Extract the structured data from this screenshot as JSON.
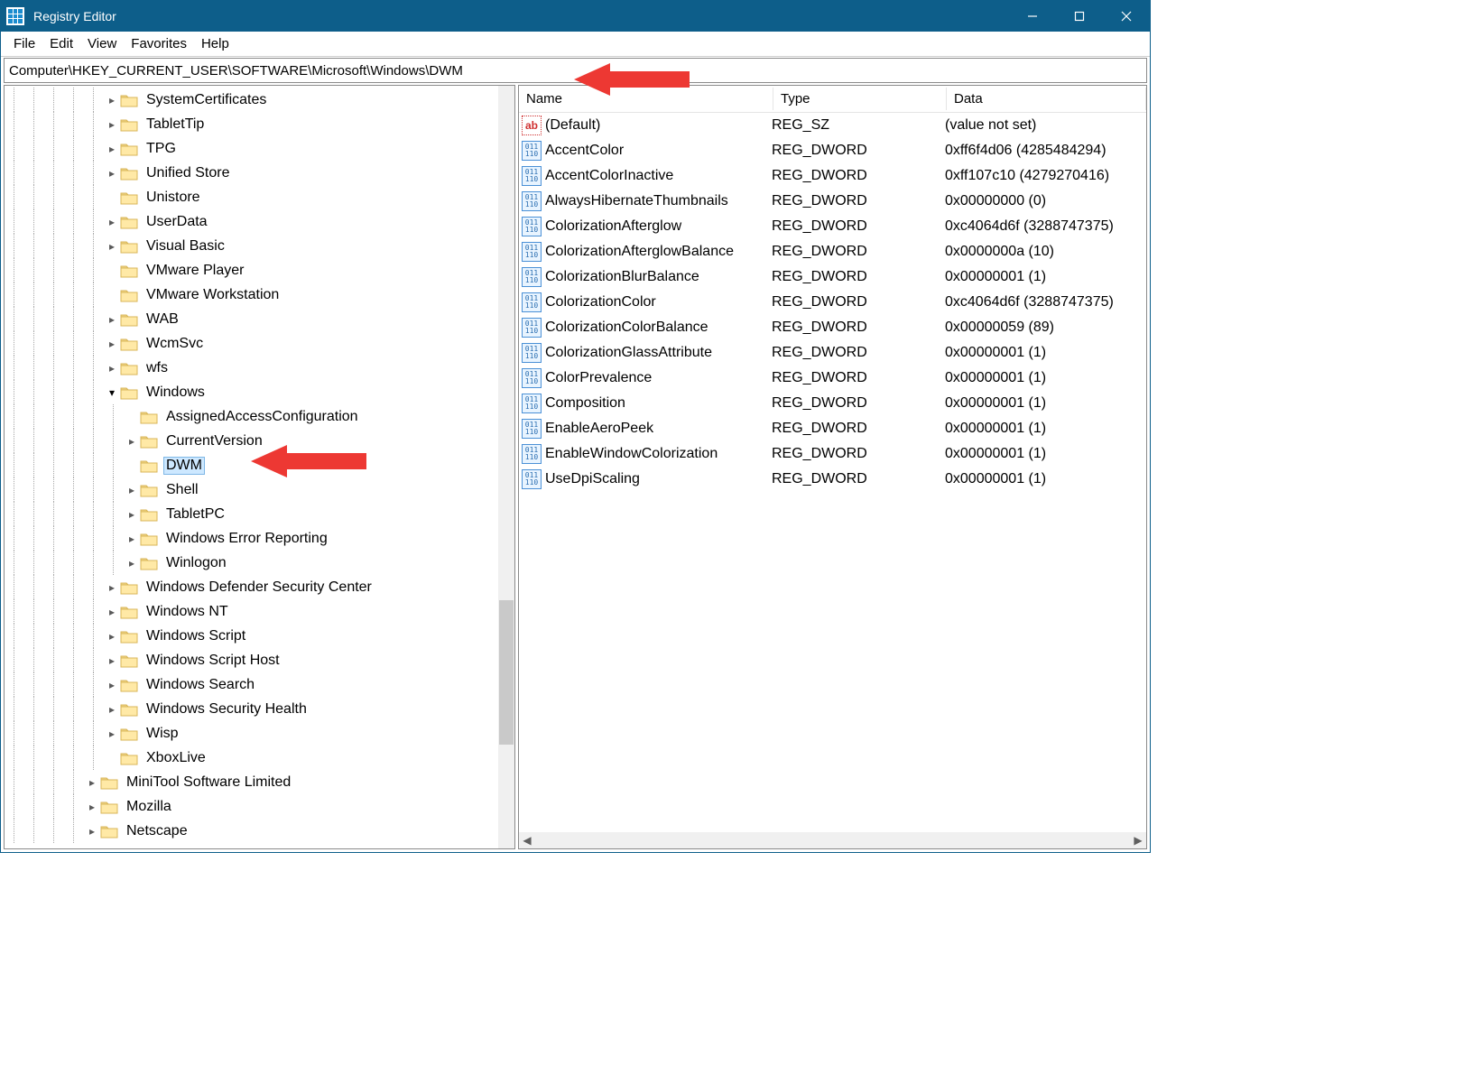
{
  "window": {
    "title": "Registry Editor"
  },
  "menubar": [
    "File",
    "Edit",
    "View",
    "Favorites",
    "Help"
  ],
  "address": "Computer\\HKEY_CURRENT_USER\\SOFTWARE\\Microsoft\\Windows\\DWM",
  "tree": [
    {
      "depth": 5,
      "exp": "collapsed",
      "label": "SystemCertificates"
    },
    {
      "depth": 5,
      "exp": "collapsed",
      "label": "TabletTip"
    },
    {
      "depth": 5,
      "exp": "collapsed",
      "label": "TPG"
    },
    {
      "depth": 5,
      "exp": "collapsed",
      "label": "Unified Store"
    },
    {
      "depth": 5,
      "exp": "none",
      "label": "Unistore"
    },
    {
      "depth": 5,
      "exp": "collapsed",
      "label": "UserData"
    },
    {
      "depth": 5,
      "exp": "collapsed",
      "label": "Visual Basic"
    },
    {
      "depth": 5,
      "exp": "none",
      "label": "VMware Player"
    },
    {
      "depth": 5,
      "exp": "none",
      "label": "VMware Workstation"
    },
    {
      "depth": 5,
      "exp": "collapsed",
      "label": "WAB"
    },
    {
      "depth": 5,
      "exp": "collapsed",
      "label": "WcmSvc"
    },
    {
      "depth": 5,
      "exp": "collapsed",
      "label": "wfs"
    },
    {
      "depth": 5,
      "exp": "expanded",
      "label": "Windows"
    },
    {
      "depth": 6,
      "exp": "none",
      "label": "AssignedAccessConfiguration"
    },
    {
      "depth": 6,
      "exp": "collapsed",
      "label": "CurrentVersion"
    },
    {
      "depth": 6,
      "exp": "none",
      "label": "DWM",
      "selected": true
    },
    {
      "depth": 6,
      "exp": "collapsed",
      "label": "Shell"
    },
    {
      "depth": 6,
      "exp": "collapsed",
      "label": "TabletPC"
    },
    {
      "depth": 6,
      "exp": "collapsed",
      "label": "Windows Error Reporting"
    },
    {
      "depth": 6,
      "exp": "collapsed",
      "label": "Winlogon"
    },
    {
      "depth": 5,
      "exp": "collapsed",
      "label": "Windows Defender Security Center"
    },
    {
      "depth": 5,
      "exp": "collapsed",
      "label": "Windows NT"
    },
    {
      "depth": 5,
      "exp": "collapsed",
      "label": "Windows Script"
    },
    {
      "depth": 5,
      "exp": "collapsed",
      "label": "Windows Script Host"
    },
    {
      "depth": 5,
      "exp": "collapsed",
      "label": "Windows Search"
    },
    {
      "depth": 5,
      "exp": "collapsed",
      "label": "Windows Security Health"
    },
    {
      "depth": 5,
      "exp": "collapsed",
      "label": "Wisp"
    },
    {
      "depth": 5,
      "exp": "none",
      "label": "XboxLive"
    },
    {
      "depth": 4,
      "exp": "collapsed",
      "label": "MiniTool Software Limited"
    },
    {
      "depth": 4,
      "exp": "collapsed",
      "label": "Mozilla"
    },
    {
      "depth": 4,
      "exp": "collapsed",
      "label": "Netscape"
    }
  ],
  "columns": {
    "name": "Name",
    "type": "Type",
    "data": "Data"
  },
  "values": [
    {
      "icon": "sz",
      "name": "(Default)",
      "type": "REG_SZ",
      "data": "(value not set)"
    },
    {
      "icon": "dw",
      "name": "AccentColor",
      "type": "REG_DWORD",
      "data": "0xff6f4d06 (4285484294)"
    },
    {
      "icon": "dw",
      "name": "AccentColorInactive",
      "type": "REG_DWORD",
      "data": "0xff107c10 (4279270416)"
    },
    {
      "icon": "dw",
      "name": "AlwaysHibernateThumbnails",
      "type": "REG_DWORD",
      "data": "0x00000000 (0)"
    },
    {
      "icon": "dw",
      "name": "ColorizationAfterglow",
      "type": "REG_DWORD",
      "data": "0xc4064d6f (3288747375)"
    },
    {
      "icon": "dw",
      "name": "ColorizationAfterglowBalance",
      "type": "REG_DWORD",
      "data": "0x0000000a (10)"
    },
    {
      "icon": "dw",
      "name": "ColorizationBlurBalance",
      "type": "REG_DWORD",
      "data": "0x00000001 (1)"
    },
    {
      "icon": "dw",
      "name": "ColorizationColor",
      "type": "REG_DWORD",
      "data": "0xc4064d6f (3288747375)"
    },
    {
      "icon": "dw",
      "name": "ColorizationColorBalance",
      "type": "REG_DWORD",
      "data": "0x00000059 (89)"
    },
    {
      "icon": "dw",
      "name": "ColorizationGlassAttribute",
      "type": "REG_DWORD",
      "data": "0x00000001 (1)"
    },
    {
      "icon": "dw",
      "name": "ColorPrevalence",
      "type": "REG_DWORD",
      "data": "0x00000001 (1)"
    },
    {
      "icon": "dw",
      "name": "Composition",
      "type": "REG_DWORD",
      "data": "0x00000001 (1)"
    },
    {
      "icon": "dw",
      "name": "EnableAeroPeek",
      "type": "REG_DWORD",
      "data": "0x00000001 (1)"
    },
    {
      "icon": "dw",
      "name": "EnableWindowColorization",
      "type": "REG_DWORD",
      "data": "0x00000001 (1)"
    },
    {
      "icon": "dw",
      "name": "UseDpiScaling",
      "type": "REG_DWORD",
      "data": "0x00000001 (1)"
    }
  ]
}
